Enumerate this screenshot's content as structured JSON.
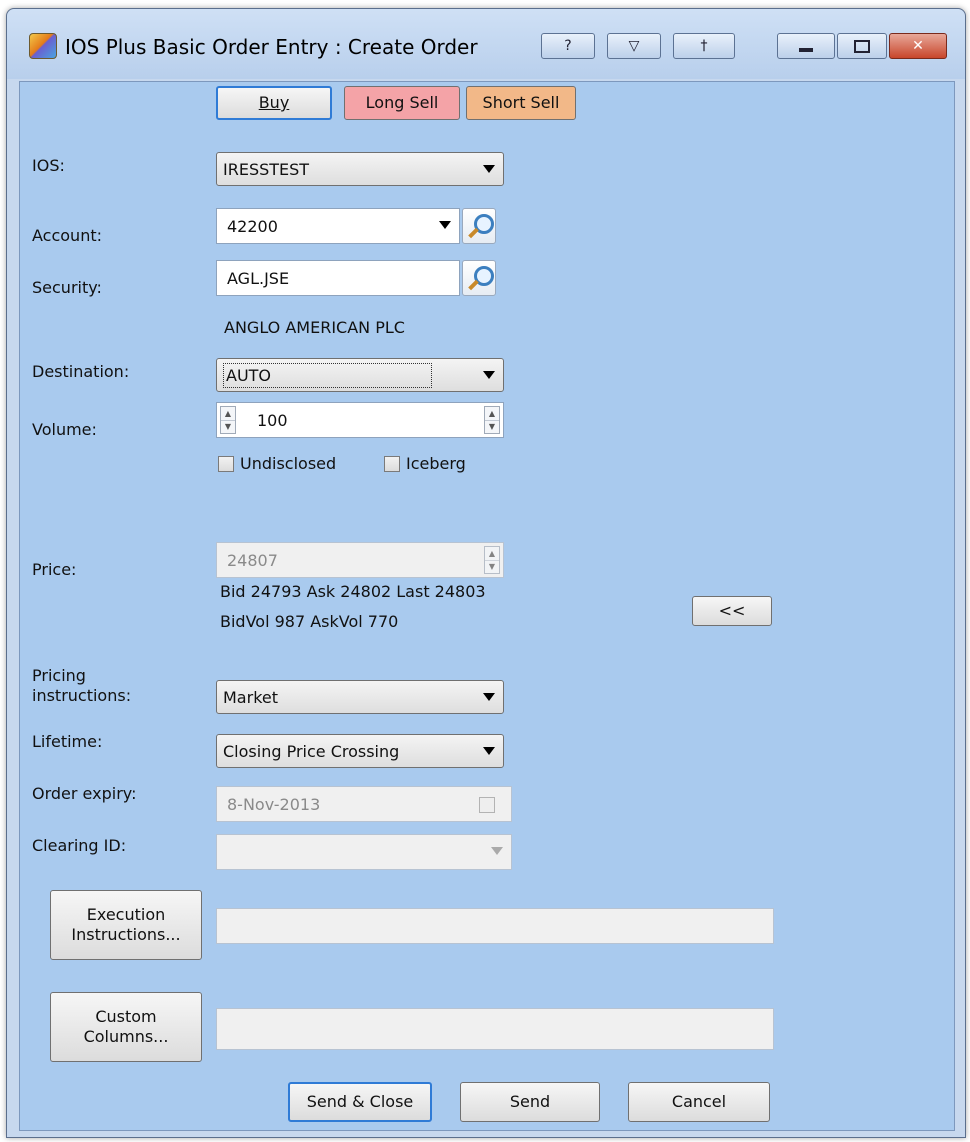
{
  "window": {
    "title": "IOS Plus Basic Order Entry : Create Order",
    "title_buttons": [
      "?",
      "▽",
      "†"
    ]
  },
  "side_buttons": {
    "buy": "Buy",
    "long_sell": "Long Sell",
    "short_sell": "Short Sell"
  },
  "fields": {
    "ios": {
      "label": "IOS:",
      "value": "IRESSTEST"
    },
    "account": {
      "label": "Account:",
      "value": "42200"
    },
    "security": {
      "label": "Security:",
      "value": "AGL.JSE",
      "name": "ANGLO AMERICAN PLC"
    },
    "destination": {
      "label": "Destination:",
      "value": "AUTO"
    },
    "volume": {
      "label": "Volume:",
      "value": "100"
    },
    "undisclosed": {
      "label": "Undisclosed",
      "checked": false
    },
    "iceberg": {
      "label": "Iceberg",
      "checked": false
    },
    "price": {
      "label": "Price:",
      "value": "24807",
      "quote_line1": "Bid 24793 Ask 24802 Last 24803",
      "quote_line2": "BidVol 987 AskVol 770",
      "copy_button": "<<"
    },
    "pricing_instructions": {
      "label_line1": "Pricing",
      "label_line2": "instructions:",
      "value": "Market"
    },
    "lifetime": {
      "label": "Lifetime:",
      "value": "Closing Price Crossing"
    },
    "order_expiry": {
      "label": "Order expiry:",
      "value": "8-Nov-2013"
    },
    "clearing_id": {
      "label": "Clearing ID:",
      "value": ""
    }
  },
  "extra_buttons": {
    "execution_line1": "Execution",
    "execution_line2": "Instructions...",
    "custom_line1": "Custom",
    "custom_line2": "Columns..."
  },
  "footer": {
    "send_close": "Send & Close",
    "send": "Send",
    "cancel": "Cancel"
  },
  "colors": {
    "panel_bg": "#a9caee",
    "long_sell": "#f4a3a7",
    "short_sell": "#f2b888",
    "default_button_border": "#2f7bd6"
  }
}
